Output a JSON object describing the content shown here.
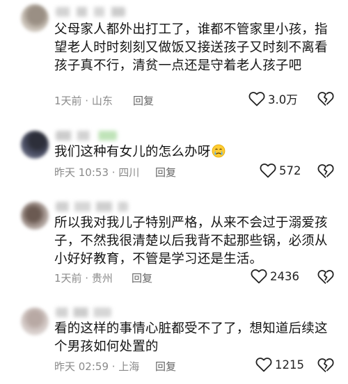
{
  "comments": [
    {
      "text": "父母家人都外出打工了，谁都不管家里小孩，指望老人时时刻刻又做饭又接送孩子又时刻不离看孩子真不行，清贫一点还是守着老人孩子吧",
      "meta": "1天前 · 山东",
      "reply_label": "回复",
      "likes": "3.0万"
    },
    {
      "text": "我们这种有女儿的怎么办呀",
      "emoji": "crying-face-icon",
      "meta": "昨天 10:53 · 四川",
      "reply_label": "回复",
      "likes": "572"
    },
    {
      "text": "所以我对我儿子特别严格，从来不会过于溺爱孩子，不然我很清楚以后我背不起那些锅，必须从小好好教育，不管是学习还是生活。",
      "meta": "1天前 · 贵州",
      "reply_label": "回复",
      "likes": "2436"
    },
    {
      "text": "看的这样的事情心脏都受不了了，想知道后续这个男孩如何处置的",
      "meta": "昨天 02:59 · 上海",
      "reply_label": "回复",
      "likes": "1215"
    }
  ],
  "colors": {
    "text": "#141414",
    "meta": "#8a8a8a",
    "icon": "#222222"
  }
}
